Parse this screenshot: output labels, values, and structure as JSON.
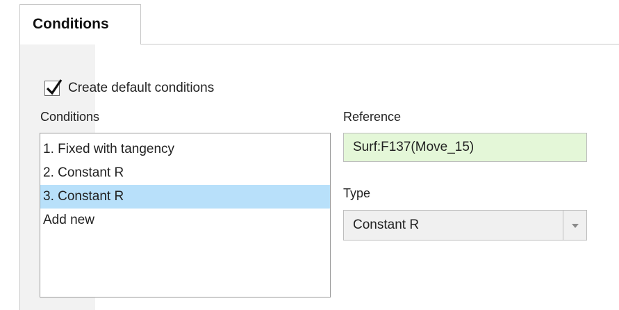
{
  "tab": {
    "label": "Conditions"
  },
  "create_default": {
    "label": "Create default conditions",
    "checked": true
  },
  "conditions": {
    "label": "Conditions",
    "items": [
      "1. Fixed with tangency",
      "2. Constant R",
      "3. Constant R",
      "Add new"
    ],
    "selected_index": 2
  },
  "reference": {
    "label": "Reference",
    "value": "Surf:F137(Move_15)"
  },
  "type": {
    "label": "Type",
    "value": "Constant R"
  },
  "icons": {
    "checkbox": "check-icon",
    "dropdown": "chevron-down-icon"
  },
  "colors": {
    "selection": "#b8e0fa",
    "reference_bg": "#e4f7d8"
  }
}
